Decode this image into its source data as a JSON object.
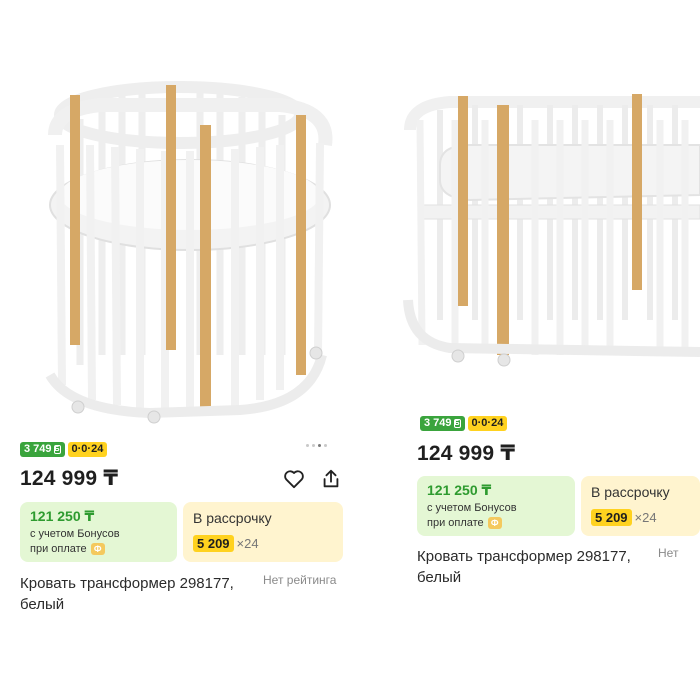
{
  "colors": {
    "bonus_green": "#3aa43d",
    "bonus_box_bg": "#e4f7d4",
    "installment_yellow": "#ffd21f",
    "installment_box_bg": "#fff4cf",
    "crib_white": "#f4f4f4",
    "crib_wood": "#d6a866"
  },
  "products": [
    {
      "image_alt_icon": "crib-oval-icon",
      "carousel_dots": 4,
      "badge_bonus": "3 749",
      "badge_installment": "0·0·24",
      "price": "124 999 ₸",
      "bonus_price": "121 250 ₸",
      "bonus_line1": "с учетом Бонусов",
      "bonus_line2": "при оплате",
      "installment_title": "В рассрочку",
      "installment_amount": "5 209",
      "installment_mult": "×24",
      "title": "Кровать трансформер 298177, белый",
      "rating": "Нет рейтинга"
    },
    {
      "image_alt_icon": "crib-extended-icon",
      "badge_bonus": "3 749",
      "badge_installment": "0·0·24",
      "price": "124 999 ₸",
      "bonus_price": "121 250 ₸",
      "bonus_line1": "с учетом Бонусов",
      "bonus_line2": "при оплате",
      "installment_title": "В рассрочку",
      "installment_amount": "5 209",
      "installment_mult": "×24",
      "title": "Кровать трансформер 298177, белый",
      "rating": "Нет"
    }
  ]
}
